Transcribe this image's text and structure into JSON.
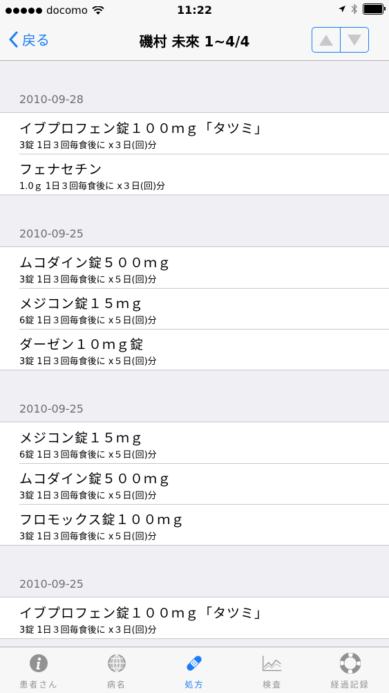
{
  "status_bar": {
    "carrier": "docomo",
    "time": "11:22"
  },
  "nav": {
    "back_label": "戻る",
    "title": "磯村 未來 1~4/4"
  },
  "sections": [
    {
      "date": "2010-09-28",
      "items": [
        {
          "name": "イブプロフェン錠１００ｍｇ「タツミ」",
          "dosage": "3錠 1日３回毎食後に x３日(回)分"
        },
        {
          "name": "フェナセチン",
          "dosage": "1.0ｇ 1日３回毎食後に x３日(回)分"
        }
      ]
    },
    {
      "date": "2010-09-25",
      "items": [
        {
          "name": "ムコダイン錠５００ｍｇ",
          "dosage": "3錠 1日３回毎食後に x５日(回)分"
        },
        {
          "name": "メジコン錠１５ｍｇ",
          "dosage": "6錠 1日３回毎食後に x５日(回)分"
        },
        {
          "name": "ダーゼン１０ｍｇ錠",
          "dosage": "3錠 1日３回毎食後に x５日(回)分"
        }
      ]
    },
    {
      "date": "2010-09-25",
      "items": [
        {
          "name": "メジコン錠１５ｍｇ",
          "dosage": "6錠 1日３回毎食後に x５日(回)分"
        },
        {
          "name": "ムコダイン錠５００ｍｇ",
          "dosage": "3錠 1日３回毎食後に x５日(回)分"
        },
        {
          "name": "フロモックス錠１００ｍｇ",
          "dosage": "3錠 1日３回毎食後に x５日(回)分"
        }
      ]
    },
    {
      "date": "2010-09-25",
      "items": [
        {
          "name": "イブプロフェン錠１００ｍｇ「タツミ」",
          "dosage": "3錠 1日３回毎食後に x３日(回)分"
        }
      ]
    }
  ],
  "tabs": [
    {
      "label": "患者さん",
      "icon": "info-icon"
    },
    {
      "label": "病名",
      "icon": "globe-icon"
    },
    {
      "label": "処方",
      "icon": "bandage-icon",
      "active": true
    },
    {
      "label": "検査",
      "icon": "chart-icon"
    },
    {
      "label": "経過記録",
      "icon": "lifebuoy-icon"
    }
  ],
  "colors": {
    "accent": "#1a7df6",
    "inactive": "#929292",
    "background": "#efeff4"
  }
}
